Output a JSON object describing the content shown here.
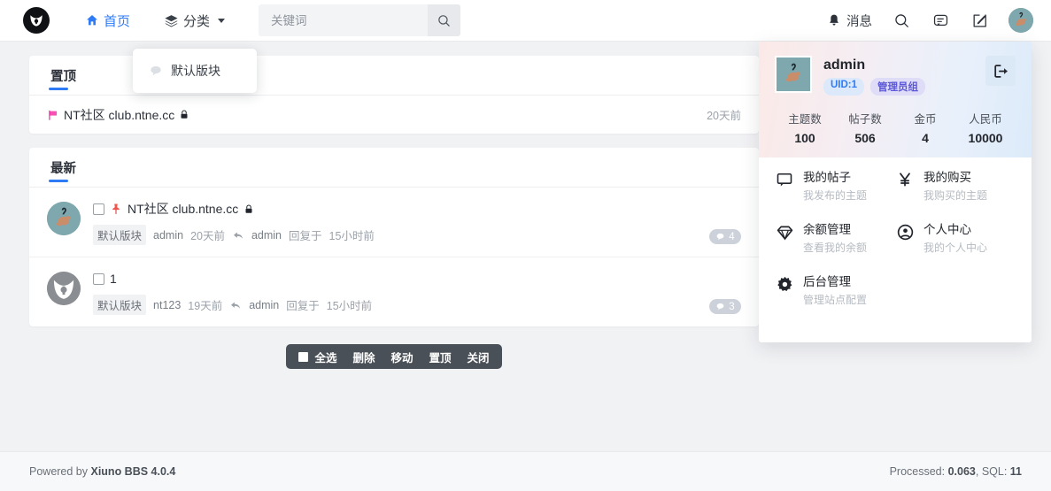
{
  "header": {
    "logo": "site-logo",
    "nav": [
      {
        "label": "首页",
        "icon": "home-icon",
        "active": true
      },
      {
        "label": "分类",
        "icon": "layers-icon",
        "active": false
      }
    ],
    "search": {
      "placeholder": "关键词",
      "value": "",
      "icon": "search-icon"
    },
    "right": {
      "messages_label": "消息",
      "messages_icon": "bell-icon",
      "search_icon": "search-icon",
      "chat_icon": "chat-icon",
      "compose_icon": "compose-icon",
      "avatar": "user-avatar"
    }
  },
  "category_dropdown": {
    "visible": true,
    "items": [
      {
        "label": "默认版块",
        "icon": "comment-icon"
      }
    ]
  },
  "pinned_card": {
    "tab": "置顶",
    "rows": [
      {
        "flag_icon": "pink-flag-icon",
        "title": "NT社区 club.ntne.cc",
        "lock_icon": "lock-icon",
        "time": "20天前"
      }
    ]
  },
  "latest_card": {
    "tab": "最新",
    "threads": [
      {
        "avatar": "avatar-admin",
        "checkbox_checked": false,
        "pin_icon": "pushpin-icon",
        "title": "NT社区 club.ntne.cc",
        "lock_icon": "lock-icon",
        "forum": "默认版块",
        "author": "admin",
        "time": "20天前",
        "reply_arrow_icon": "reply-arrow-icon",
        "last_replier": "admin",
        "reply_text": "回复于",
        "last_reply_time": "15小时前",
        "replies": "4"
      },
      {
        "avatar": "avatar-nt123",
        "checkbox_checked": false,
        "pin_icon": "",
        "title": "1",
        "lock_icon": "",
        "forum": "默认版块",
        "author": "nt123",
        "time": "19天前",
        "reply_arrow_icon": "reply-arrow-icon",
        "last_replier": "admin",
        "reply_text": "回复于",
        "last_reply_time": "15小时前",
        "replies": "3"
      }
    ]
  },
  "action_bar": {
    "select_all": "全选",
    "delete": "删除",
    "move": "移动",
    "pin": "置顶",
    "close": "关闭"
  },
  "user_panel": {
    "username": "admin",
    "uid_tag": "UID:1",
    "group_tag": "管理员组",
    "logout_icon": "logout-icon",
    "stats": [
      {
        "label": "主题数",
        "value": "100"
      },
      {
        "label": "帖子数",
        "value": "506"
      },
      {
        "label": "金币",
        "value": "4"
      },
      {
        "label": "人民币",
        "value": "10000"
      }
    ],
    "menu": [
      {
        "icon": "comment-icon",
        "title": "我的帖子",
        "sub": "我发布的主题"
      },
      {
        "icon": "yen-icon",
        "title": "我的购买",
        "sub": "我购买的主题"
      },
      {
        "icon": "diamond-icon",
        "title": "余额管理",
        "sub": "查看我的余额"
      },
      {
        "icon": "user-circle-icon",
        "title": "个人中心",
        "sub": "我的个人中心"
      },
      {
        "icon": "gear-icon",
        "title": "后台管理",
        "sub": "管理站点配置"
      }
    ]
  },
  "footer": {
    "powered_prefix": "Powered by ",
    "powered_name": "Xiuno BBS 4.0.4",
    "stats_prefix": "Processed: ",
    "processed": "0.063",
    "sql_prefix": ", SQL: ",
    "sql": "11"
  },
  "colors": {
    "accent": "#2f7bf6",
    "page_bg": "#f1f2f4",
    "actionbar": "#4a5058",
    "badge": "#ccd1da"
  }
}
